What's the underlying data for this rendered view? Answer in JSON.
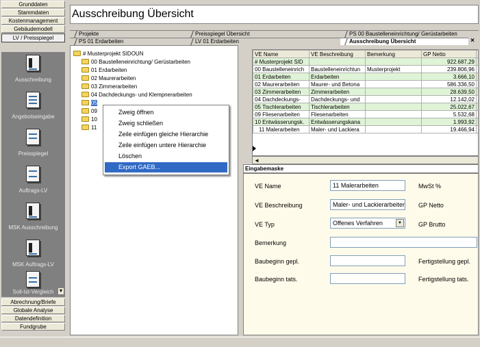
{
  "nav": {
    "top_buttons": [
      "Grunddaten",
      "Stammdaten",
      "Kostenmanagement",
      "Gebäudemodell",
      "LV / Preisspiegel"
    ],
    "items": [
      "Ausschreibung",
      "Angebotseingabe",
      "Preisspiegel",
      "Auftrags-LV",
      "MSK Ausschreibung",
      "MSK Auftrags-LV",
      "Soll-Ist-Vergleich"
    ],
    "bottom_buttons": [
      "Abrechnung/Briefe",
      "Globale Analyse",
      "Datendefinition",
      "Fundgrube"
    ]
  },
  "header": {
    "title": "Ausschreibung Übersicht",
    "crumbs_row1": [
      "Projekte",
      "Preisspiegel Übersicht",
      "PS 00 Baustelleneinrichtung/ Gerüstarbeiten"
    ],
    "crumbs_row2": [
      "PS 01 Erdarbeiten",
      "LV 01 Erdarbeiten",
      "Ausschreibung Übersicht"
    ],
    "close_symbol": "×"
  },
  "tree": {
    "root": "# Musterprojekt SIDOUN",
    "children": [
      "00 Baustelleneinrichtung/ Gerüstarbeiten",
      "01 Erdarbeiten",
      "02 Maurerarbeiten",
      "03 Zimmerarbeiten",
      "04 Dachdeckungs- und Klempnerarbeiten",
      "05",
      "09",
      "10",
      "11"
    ]
  },
  "context_menu": {
    "items": [
      "Zweig öffnen",
      "Zweig schließen",
      "Zeile einfügen gleiche Hierarchie",
      "Zeile einfügen untere Hierarchie",
      "Löschen",
      "Export GAEB..."
    ],
    "highlighted_index": 5
  },
  "grid": {
    "columns": [
      "VE Name",
      "VE Beschreibung",
      "Bemerkung",
      "GP Netto",
      "M"
    ],
    "rows": [
      [
        "# Musterprojekt SID",
        "",
        "",
        "922.687,29"
      ],
      [
        "00 Baustelleneinrich",
        "Baustelleneinrichtun",
        "Musterprojekt",
        "239.806,96"
      ],
      [
        "01 Erdarbeiten",
        "Erdarbeiten",
        "",
        "3.666,10"
      ],
      [
        "02 Maurerarbeiten",
        "Maurer- und Betona",
        "",
        "586.336,50"
      ],
      [
        "03 Zimmerarbeiten",
        "Zimmerarbeiten",
        "",
        "28.639,50"
      ],
      [
        "04 Dachdeckungs-",
        "Dachdeckungs- und",
        "",
        "12.142,02"
      ],
      [
        "05 Tischlerarbeiten",
        "Tischlerarbeiten",
        "",
        "25.022,67"
      ],
      [
        "09 Fliesenarbeiten",
        "Fliesenarbeiten",
        "",
        "5.532,68"
      ],
      [
        "10 Entwässerungsk.",
        "Entwässerungskana",
        "",
        "1.993,92"
      ],
      [
        "11 Malerarbeiten",
        "Maler- und Lackiera",
        "",
        "19.466,94"
      ]
    ],
    "scroll_left_symbol": "◄"
  },
  "form": {
    "header": "Eingabemaske",
    "ve_name_label": "VE Name",
    "ve_name_value": "11 Malerarbeiten",
    "ve_beschreibung_label": "VE Beschreibung",
    "ve_beschreibung_value": "Maler- und Lackierarbeiten",
    "ve_typ_label": "VE Typ",
    "ve_typ_value": "Offenes Verfahren",
    "bemerkung_label": "Bemerkung",
    "baubeginn_gepl_label": "Baubeginn gepl.",
    "baubeginn_tats_label": "Baubeginn tats.",
    "mwst_label": "MwSt %",
    "gp_netto_label": "GP Netto",
    "gp_brutto_label": "GP Brutto",
    "fertig_gepl_label": "Fertigstellung gepl.",
    "fertig_tats_label": "Fertigstellung tats."
  }
}
